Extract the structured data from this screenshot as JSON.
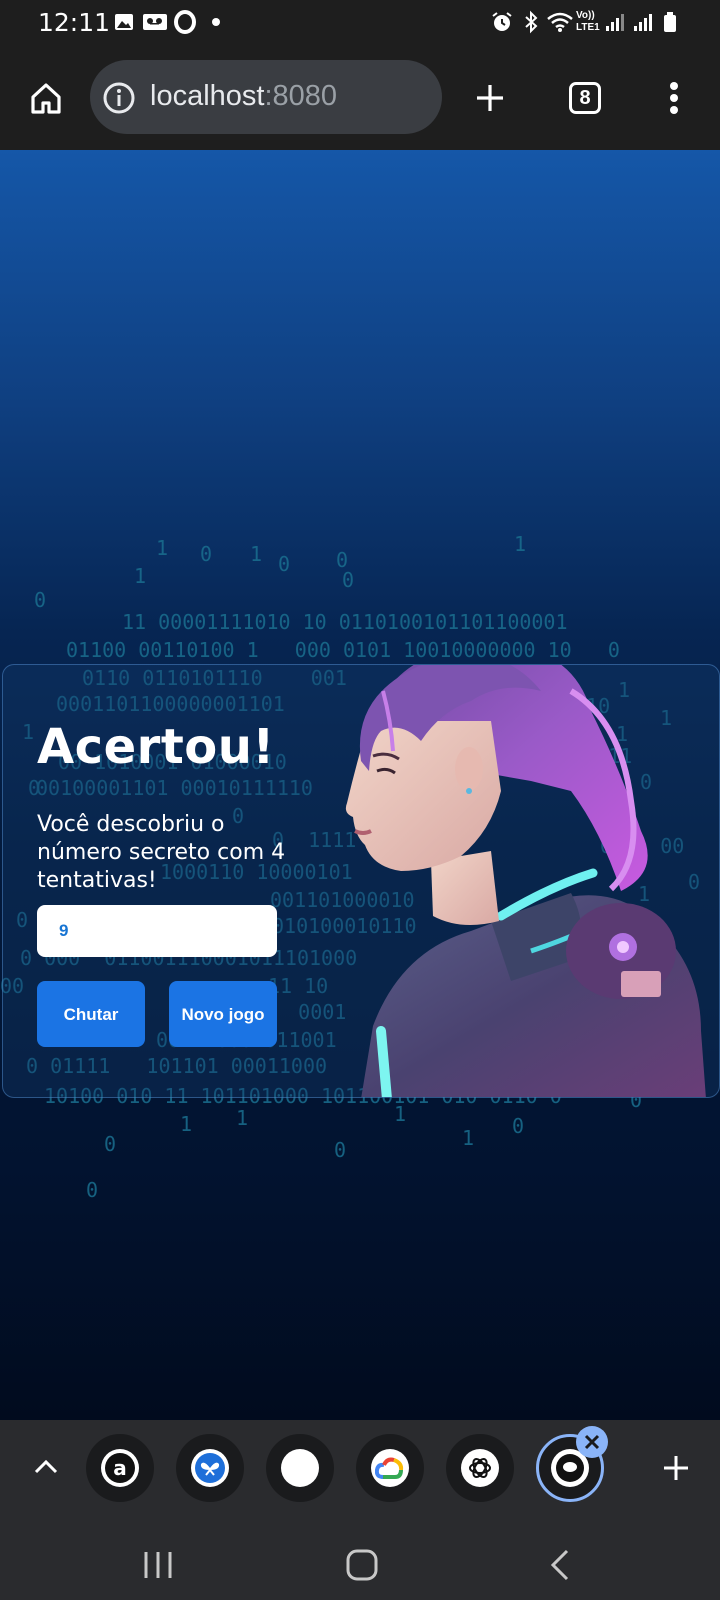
{
  "status_bar": {
    "time": "12:11",
    "left_icons": [
      "image-icon",
      "voicemail-icon",
      "opera-icon",
      "dot-icon"
    ],
    "right_icons": [
      "alarm-icon",
      "bluetooth-icon",
      "wifi-icon",
      "volte-icon",
      "signal-icon",
      "signal-icon",
      "battery-icon"
    ],
    "volte_label": "Vo)) LTE1"
  },
  "browser": {
    "url_host": "localhost",
    "url_port": ":8080",
    "tab_count": "8",
    "icons": [
      "home-icon",
      "info-icon",
      "new-tab-icon",
      "tabs-icon",
      "menu-icon"
    ]
  },
  "game": {
    "title": "Acertou!",
    "message": "Você descobriu o número secreto com 4 tentativas!",
    "input_value": "9",
    "guess_button": "Chutar",
    "new_game_button": "Novo jogo",
    "accent_color": "#1b74e4"
  },
  "tab_strip": {
    "favicons": [
      "amazon-icon",
      "butterfly-app-icon",
      "blank-icon",
      "google-cloud-icon",
      "chatgpt-icon",
      "web-app-icon"
    ],
    "icons": [
      "chevron-up-icon",
      "close-tab-icon",
      "add-tab-icon"
    ]
  },
  "nav_bar": {
    "icons": [
      "recent-apps-icon",
      "home-icon",
      "back-icon"
    ]
  }
}
